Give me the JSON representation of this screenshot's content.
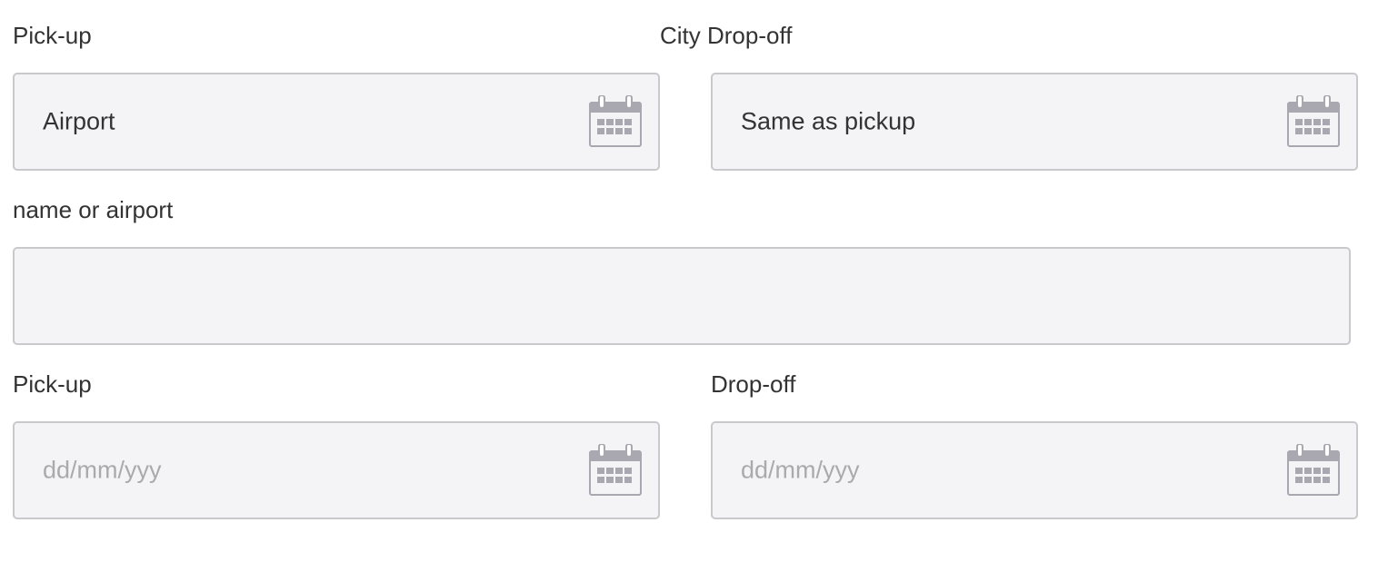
{
  "row1": {
    "pickup_label": "Pick-up",
    "dropoff_label": "City Drop-off",
    "pickup_value": "Airport",
    "dropoff_value": "Same as pickup"
  },
  "row2": {
    "label": "name or airport",
    "value": ""
  },
  "row3": {
    "pickup_label": "Pick-up",
    "dropoff_label": "Drop-off",
    "pickup_placeholder": "dd/mm/yyy",
    "dropoff_placeholder": "dd/mm/yyy"
  },
  "icons": {
    "calendar": "calendar-icon"
  },
  "colors": {
    "field_bg": "#f4f4f6",
    "field_border": "#c9c9cd",
    "icon": "#a9a7b0",
    "text": "#333333",
    "placeholder": "#aaaaae"
  }
}
